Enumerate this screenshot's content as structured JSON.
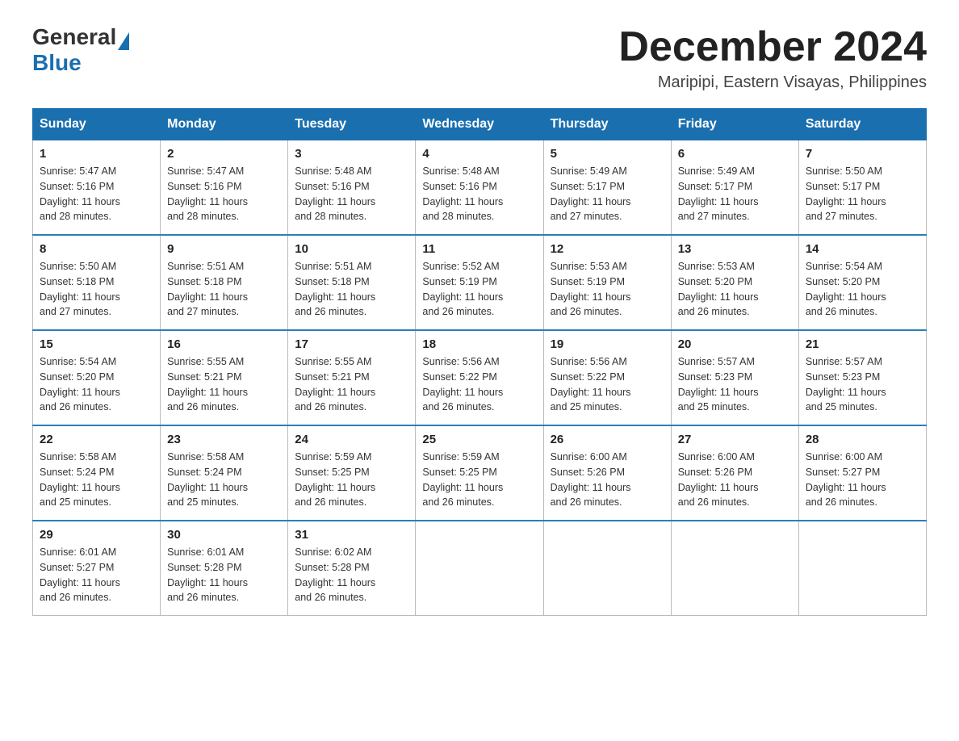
{
  "header": {
    "logo_general": "General",
    "logo_blue": "Blue",
    "month_title": "December 2024",
    "location": "Maripipi, Eastern Visayas, Philippines"
  },
  "days_of_week": [
    "Sunday",
    "Monday",
    "Tuesday",
    "Wednesday",
    "Thursday",
    "Friday",
    "Saturday"
  ],
  "weeks": [
    [
      {
        "day": "1",
        "sunrise": "5:47 AM",
        "sunset": "5:16 PM",
        "daylight": "11 hours and 28 minutes."
      },
      {
        "day": "2",
        "sunrise": "5:47 AM",
        "sunset": "5:16 PM",
        "daylight": "11 hours and 28 minutes."
      },
      {
        "day": "3",
        "sunrise": "5:48 AM",
        "sunset": "5:16 PM",
        "daylight": "11 hours and 28 minutes."
      },
      {
        "day": "4",
        "sunrise": "5:48 AM",
        "sunset": "5:16 PM",
        "daylight": "11 hours and 28 minutes."
      },
      {
        "day": "5",
        "sunrise": "5:49 AM",
        "sunset": "5:17 PM",
        "daylight": "11 hours and 27 minutes."
      },
      {
        "day": "6",
        "sunrise": "5:49 AM",
        "sunset": "5:17 PM",
        "daylight": "11 hours and 27 minutes."
      },
      {
        "day": "7",
        "sunrise": "5:50 AM",
        "sunset": "5:17 PM",
        "daylight": "11 hours and 27 minutes."
      }
    ],
    [
      {
        "day": "8",
        "sunrise": "5:50 AM",
        "sunset": "5:18 PM",
        "daylight": "11 hours and 27 minutes."
      },
      {
        "day": "9",
        "sunrise": "5:51 AM",
        "sunset": "5:18 PM",
        "daylight": "11 hours and 27 minutes."
      },
      {
        "day": "10",
        "sunrise": "5:51 AM",
        "sunset": "5:18 PM",
        "daylight": "11 hours and 26 minutes."
      },
      {
        "day": "11",
        "sunrise": "5:52 AM",
        "sunset": "5:19 PM",
        "daylight": "11 hours and 26 minutes."
      },
      {
        "day": "12",
        "sunrise": "5:53 AM",
        "sunset": "5:19 PM",
        "daylight": "11 hours and 26 minutes."
      },
      {
        "day": "13",
        "sunrise": "5:53 AM",
        "sunset": "5:20 PM",
        "daylight": "11 hours and 26 minutes."
      },
      {
        "day": "14",
        "sunrise": "5:54 AM",
        "sunset": "5:20 PM",
        "daylight": "11 hours and 26 minutes."
      }
    ],
    [
      {
        "day": "15",
        "sunrise": "5:54 AM",
        "sunset": "5:20 PM",
        "daylight": "11 hours and 26 minutes."
      },
      {
        "day": "16",
        "sunrise": "5:55 AM",
        "sunset": "5:21 PM",
        "daylight": "11 hours and 26 minutes."
      },
      {
        "day": "17",
        "sunrise": "5:55 AM",
        "sunset": "5:21 PM",
        "daylight": "11 hours and 26 minutes."
      },
      {
        "day": "18",
        "sunrise": "5:56 AM",
        "sunset": "5:22 PM",
        "daylight": "11 hours and 26 minutes."
      },
      {
        "day": "19",
        "sunrise": "5:56 AM",
        "sunset": "5:22 PM",
        "daylight": "11 hours and 25 minutes."
      },
      {
        "day": "20",
        "sunrise": "5:57 AM",
        "sunset": "5:23 PM",
        "daylight": "11 hours and 25 minutes."
      },
      {
        "day": "21",
        "sunrise": "5:57 AM",
        "sunset": "5:23 PM",
        "daylight": "11 hours and 25 minutes."
      }
    ],
    [
      {
        "day": "22",
        "sunrise": "5:58 AM",
        "sunset": "5:24 PM",
        "daylight": "11 hours and 25 minutes."
      },
      {
        "day": "23",
        "sunrise": "5:58 AM",
        "sunset": "5:24 PM",
        "daylight": "11 hours and 25 minutes."
      },
      {
        "day": "24",
        "sunrise": "5:59 AM",
        "sunset": "5:25 PM",
        "daylight": "11 hours and 26 minutes."
      },
      {
        "day": "25",
        "sunrise": "5:59 AM",
        "sunset": "5:25 PM",
        "daylight": "11 hours and 26 minutes."
      },
      {
        "day": "26",
        "sunrise": "6:00 AM",
        "sunset": "5:26 PM",
        "daylight": "11 hours and 26 minutes."
      },
      {
        "day": "27",
        "sunrise": "6:00 AM",
        "sunset": "5:26 PM",
        "daylight": "11 hours and 26 minutes."
      },
      {
        "day": "28",
        "sunrise": "6:00 AM",
        "sunset": "5:27 PM",
        "daylight": "11 hours and 26 minutes."
      }
    ],
    [
      {
        "day": "29",
        "sunrise": "6:01 AM",
        "sunset": "5:27 PM",
        "daylight": "11 hours and 26 minutes."
      },
      {
        "day": "30",
        "sunrise": "6:01 AM",
        "sunset": "5:28 PM",
        "daylight": "11 hours and 26 minutes."
      },
      {
        "day": "31",
        "sunrise": "6:02 AM",
        "sunset": "5:28 PM",
        "daylight": "11 hours and 26 minutes."
      },
      null,
      null,
      null,
      null
    ]
  ],
  "labels": {
    "sunrise": "Sunrise:",
    "sunset": "Sunset:",
    "daylight": "Daylight:"
  }
}
